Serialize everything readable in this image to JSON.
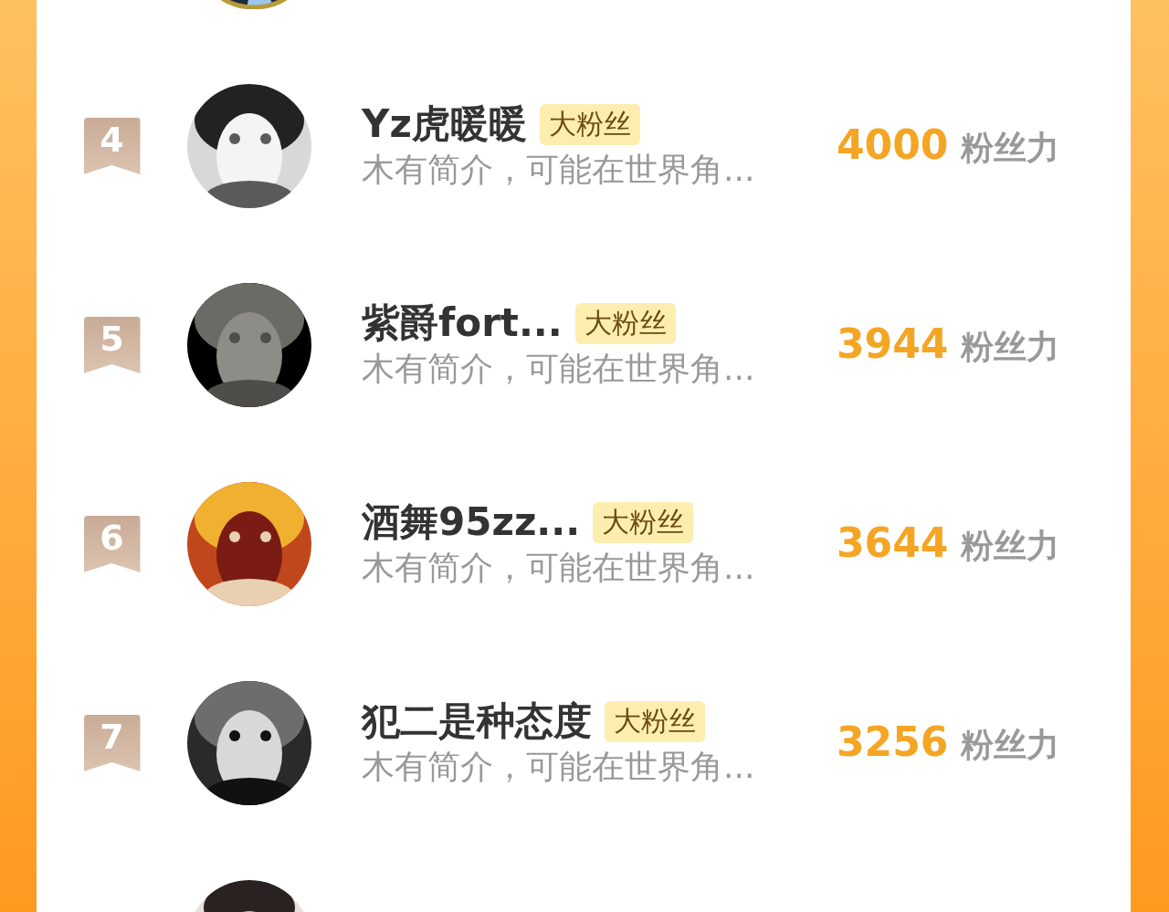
{
  "rows": [
    {
      "rank": "4",
      "name": "Yz虎暖暖",
      "badge": "大粉丝",
      "bio": "木有简介，可能在世界角...",
      "score": "4000",
      "score_unit": "粉丝力"
    },
    {
      "rank": "5",
      "name": "紫爵fort...",
      "badge": "大粉丝",
      "bio": "木有简介，可能在世界角...",
      "score": "3944",
      "score_unit": "粉丝力"
    },
    {
      "rank": "6",
      "name": "酒舞95zz...",
      "badge": "大粉丝",
      "bio": "木有简介，可能在世界角...",
      "score": "3644",
      "score_unit": "粉丝力"
    },
    {
      "rank": "7",
      "name": "犯二是种态度",
      "badge": "大粉丝",
      "bio": "木有简介，可能在世界角...",
      "score": "3256",
      "score_unit": "粉丝力"
    }
  ]
}
